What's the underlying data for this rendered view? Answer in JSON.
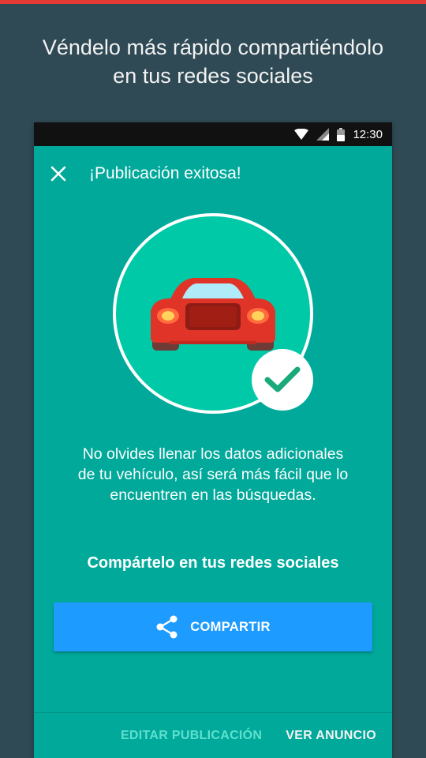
{
  "promo": {
    "title": "Véndelo más rápido compartiéndolo\nen tus redes sociales"
  },
  "status_bar": {
    "time": "12:30",
    "icons": [
      "wifi-icon",
      "signal-icon",
      "battery-icon"
    ]
  },
  "app_bar": {
    "close_icon": "close-icon",
    "title": "¡Publicación exitosa!"
  },
  "hero": {
    "image": "car-icon",
    "badge": "check-icon"
  },
  "message": "No olvides llenar los datos adicionales\nde tu vehículo, así será más fácil que lo\nencuentren en las búsquedas.",
  "share": {
    "title": "Compártelo en tus redes sociales",
    "button_label": "COMPARTIR",
    "button_icon": "share-icon"
  },
  "bottom_actions": {
    "edit_label": "EDITAR PUBLICACIÓN",
    "view_label": "VER ANUNCIO"
  },
  "colors": {
    "background": "#2f4a55",
    "screen": "#00a99a",
    "circle": "#00c9a7",
    "button": "#1e9bff",
    "check": "#1aa97a",
    "accent_top": "#e53935"
  }
}
